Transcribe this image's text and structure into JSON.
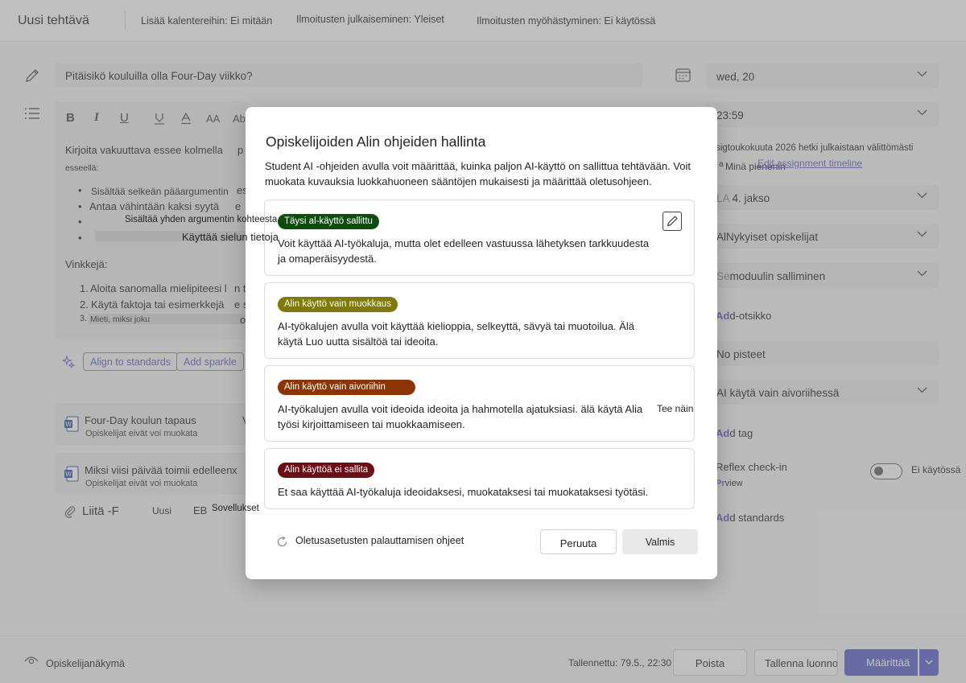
{
  "topbar": {
    "title": "Uusi tehtävä",
    "calendar_setting": "Lisää kalentereihin: Ei mitään",
    "post_notifications": "Ilmoitusten julkaiseminen: Yleiset",
    "late_notifications": "Ilmoitusten myöhästyminen: Ei käytössä"
  },
  "form": {
    "title_value": "Pitäisikö kouluilla olla Four-Day viikko?",
    "instructions": {
      "line1": "Kirjoita vakuuttava essee kolmella",
      "line1_tail": "p",
      "line2": "esseellä:",
      "bullets": [
        {
          "text": "Sisältää selkeän pääargumentin",
          "tail": "es"
        },
        {
          "text": "Antaa vähintään kaksi syytä",
          "tail": "e"
        },
        {
          "text": "Sisältää yhden argumentin kohteesta",
          "tail": ""
        },
        {
          "text": "Käyttää sielun tietoja",
          "tail": ""
        }
      ],
      "tips_label": "Vinkkejä:",
      "tips": [
        {
          "num": "1.",
          "text": "Aloita sanomalla mielipiteesi l",
          "tail": "n t"
        },
        {
          "num": "2.",
          "text": "Käytä faktoja tai esimerkkejä",
          "tail": "e s"
        },
        {
          "num": "3.",
          "text": "Mieti, miksi joku",
          "tail": "o"
        }
      ]
    },
    "toolbar": {
      "bold": "B",
      "italic": "I",
      "underline": "U",
      "text_size": "AA",
      "more": "Ab"
    },
    "buttons": {
      "align": "Align to standards",
      "sparkle": "Add sparkle"
    },
    "attachments": [
      {
        "name": "Four-Day koulun tapaus",
        "tail": "V",
        "sub": "Opiskelijat eivät voi muokata"
      },
      {
        "name": "Miksi viisi päivää toimii edelleen",
        "tail": "x",
        "sub": "Opiskelijat eivät voi muokata"
      }
    ],
    "attach_bar": {
      "attach": "Liitä -F",
      "new": "Uusi",
      "eb": "EB",
      "apps": "Sovellukset"
    }
  },
  "right": {
    "due_date": "wed, 20",
    "due_time": "23:59",
    "close_note": "sigtoukokuuta 2026 hetki julkaistaan välittömästi",
    "mini_label": "Minä pienenin",
    "a_prefix": "a",
    "timeline_link": "Edit assignment timeline",
    "grading_prefix": "LA",
    "grading_period": "4. jakso",
    "assign_prefix": "Al",
    "assign_to": "Nykyiset opiskelijat",
    "module_prefix": "Se",
    "module": "moduulin salliminen",
    "heading_prefix": "Ad",
    "heading": "d-otsikko",
    "points": "No pisteet",
    "ai_level": "AI käytä vain aivoriihessä",
    "tag_prefix": "Ad",
    "tag": "d tag",
    "reflex_title": "Reflex check-in",
    "preview_prefix": "Pr",
    "preview": "view",
    "reflex_status": "Ei käytössä",
    "standards_prefix": "Ad",
    "standards": "d standards",
    "tee_nain": "Tee näin"
  },
  "bottom": {
    "student_view": "Opiskelijanäkymä",
    "saved": "Tallennettu: 79.5., 22:30",
    "delete": "Poista",
    "save_draft": "Tallenna luonnoksena",
    "assign": "Määrittää"
  },
  "modal": {
    "title": "Opiskelijoiden Alin ohjeiden hallinta",
    "description": "Student AI -ohjeiden avulla voit määrittää, kuinka paljon AI-käyttö on sallittua tehtävään. Voit muokata kuvauksia luokkahuoneen sääntöjen mukaisesti ja määrittää oletusohjeen.",
    "levels": [
      {
        "badge": "Täysi al-käyttö sallittu",
        "text": "Voit käyttää AI-työkaluja, mutta olet edelleen vastuussa lähetyksen tarkkuudesta ja omaperäisyydestä.",
        "color": "#0e4d0e"
      },
      {
        "badge": "Alin käyttö vain muokkaus",
        "text": "AI-työkalujen avulla voit käyttää kielioppia, selkeyttä, sävyä tai muotoilua. Älä käytä Luo uutta sisältöä tai ideoita.",
        "color": "#7f7a09"
      },
      {
        "badge": "Alin käyttö vain aivoriihin",
        "text": "AI-työkalujen avulla voit ideoida ideoita ja hahmotella ajatuksiasi. älä käytä Alia työsi kirjoittamiseen tai muokkaamiseen.",
        "color": "#8b3505"
      },
      {
        "badge": "Alin käyttöä ei sallita",
        "text": "Et saa käyttää AI-työkaluja ideoidaksesi, muokataksesi tai muokataksesi työtäsi.",
        "color": "#6e0c15"
      }
    ],
    "reset": "Oletusasetusten palauttamisen ohjeet",
    "cancel": "Peruuta",
    "done": "Valmis"
  }
}
